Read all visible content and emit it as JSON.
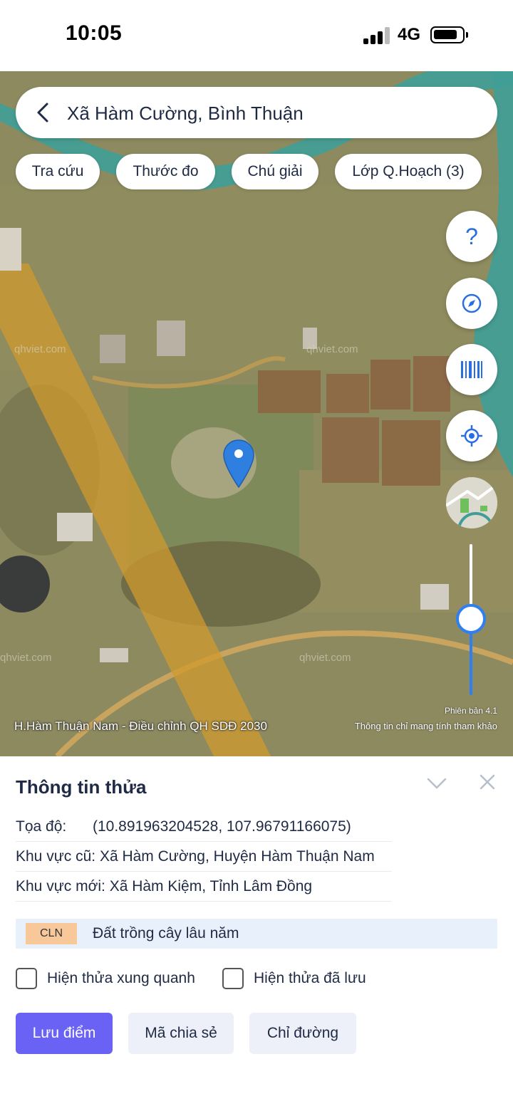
{
  "status_bar": {
    "time": "10:05",
    "network": "4G"
  },
  "search": {
    "location": "Xã Hàm Cường, Bình Thuận"
  },
  "chips": [
    "Tra cứu",
    "Thước đo",
    "Chú giải",
    "Lớp Q.Hoạch (3)"
  ],
  "map": {
    "help_symbol": "?",
    "plan_name": "H.Hàm Thuận Nam - Điều chỉnh QH SDĐ 2030",
    "version": "Phiên bản 4.1",
    "disclaimer": "Thông tin chỉ mang tính tham khảo",
    "watermark": "qhviet.com"
  },
  "sheet": {
    "title": "Thông tin thửa",
    "coord_label": "Tọa độ:",
    "coord_value": "(10.891963204528, 107.96791166075)",
    "old_area": "Khu vực cũ: Xã Hàm Cường, Huyện Hàm Thuận Nam",
    "new_area": "Khu vực mới: Xã Hàm Kiệm, Tỉnh Lâm Đồng",
    "landuse_code": "CLN",
    "landuse_name": "Đất trồng cây lâu năm",
    "check_nearby": "Hiện thửa xung quanh",
    "check_saved": "Hiện thửa đã lưu",
    "btn_save": "Lưu điểm",
    "btn_share": "Mã chia sẻ",
    "btn_directions": "Chỉ đường"
  },
  "colors": {
    "primary": "#6a62f5",
    "accent": "#2f7ff0",
    "landuse_badge": "#f8c89b"
  }
}
